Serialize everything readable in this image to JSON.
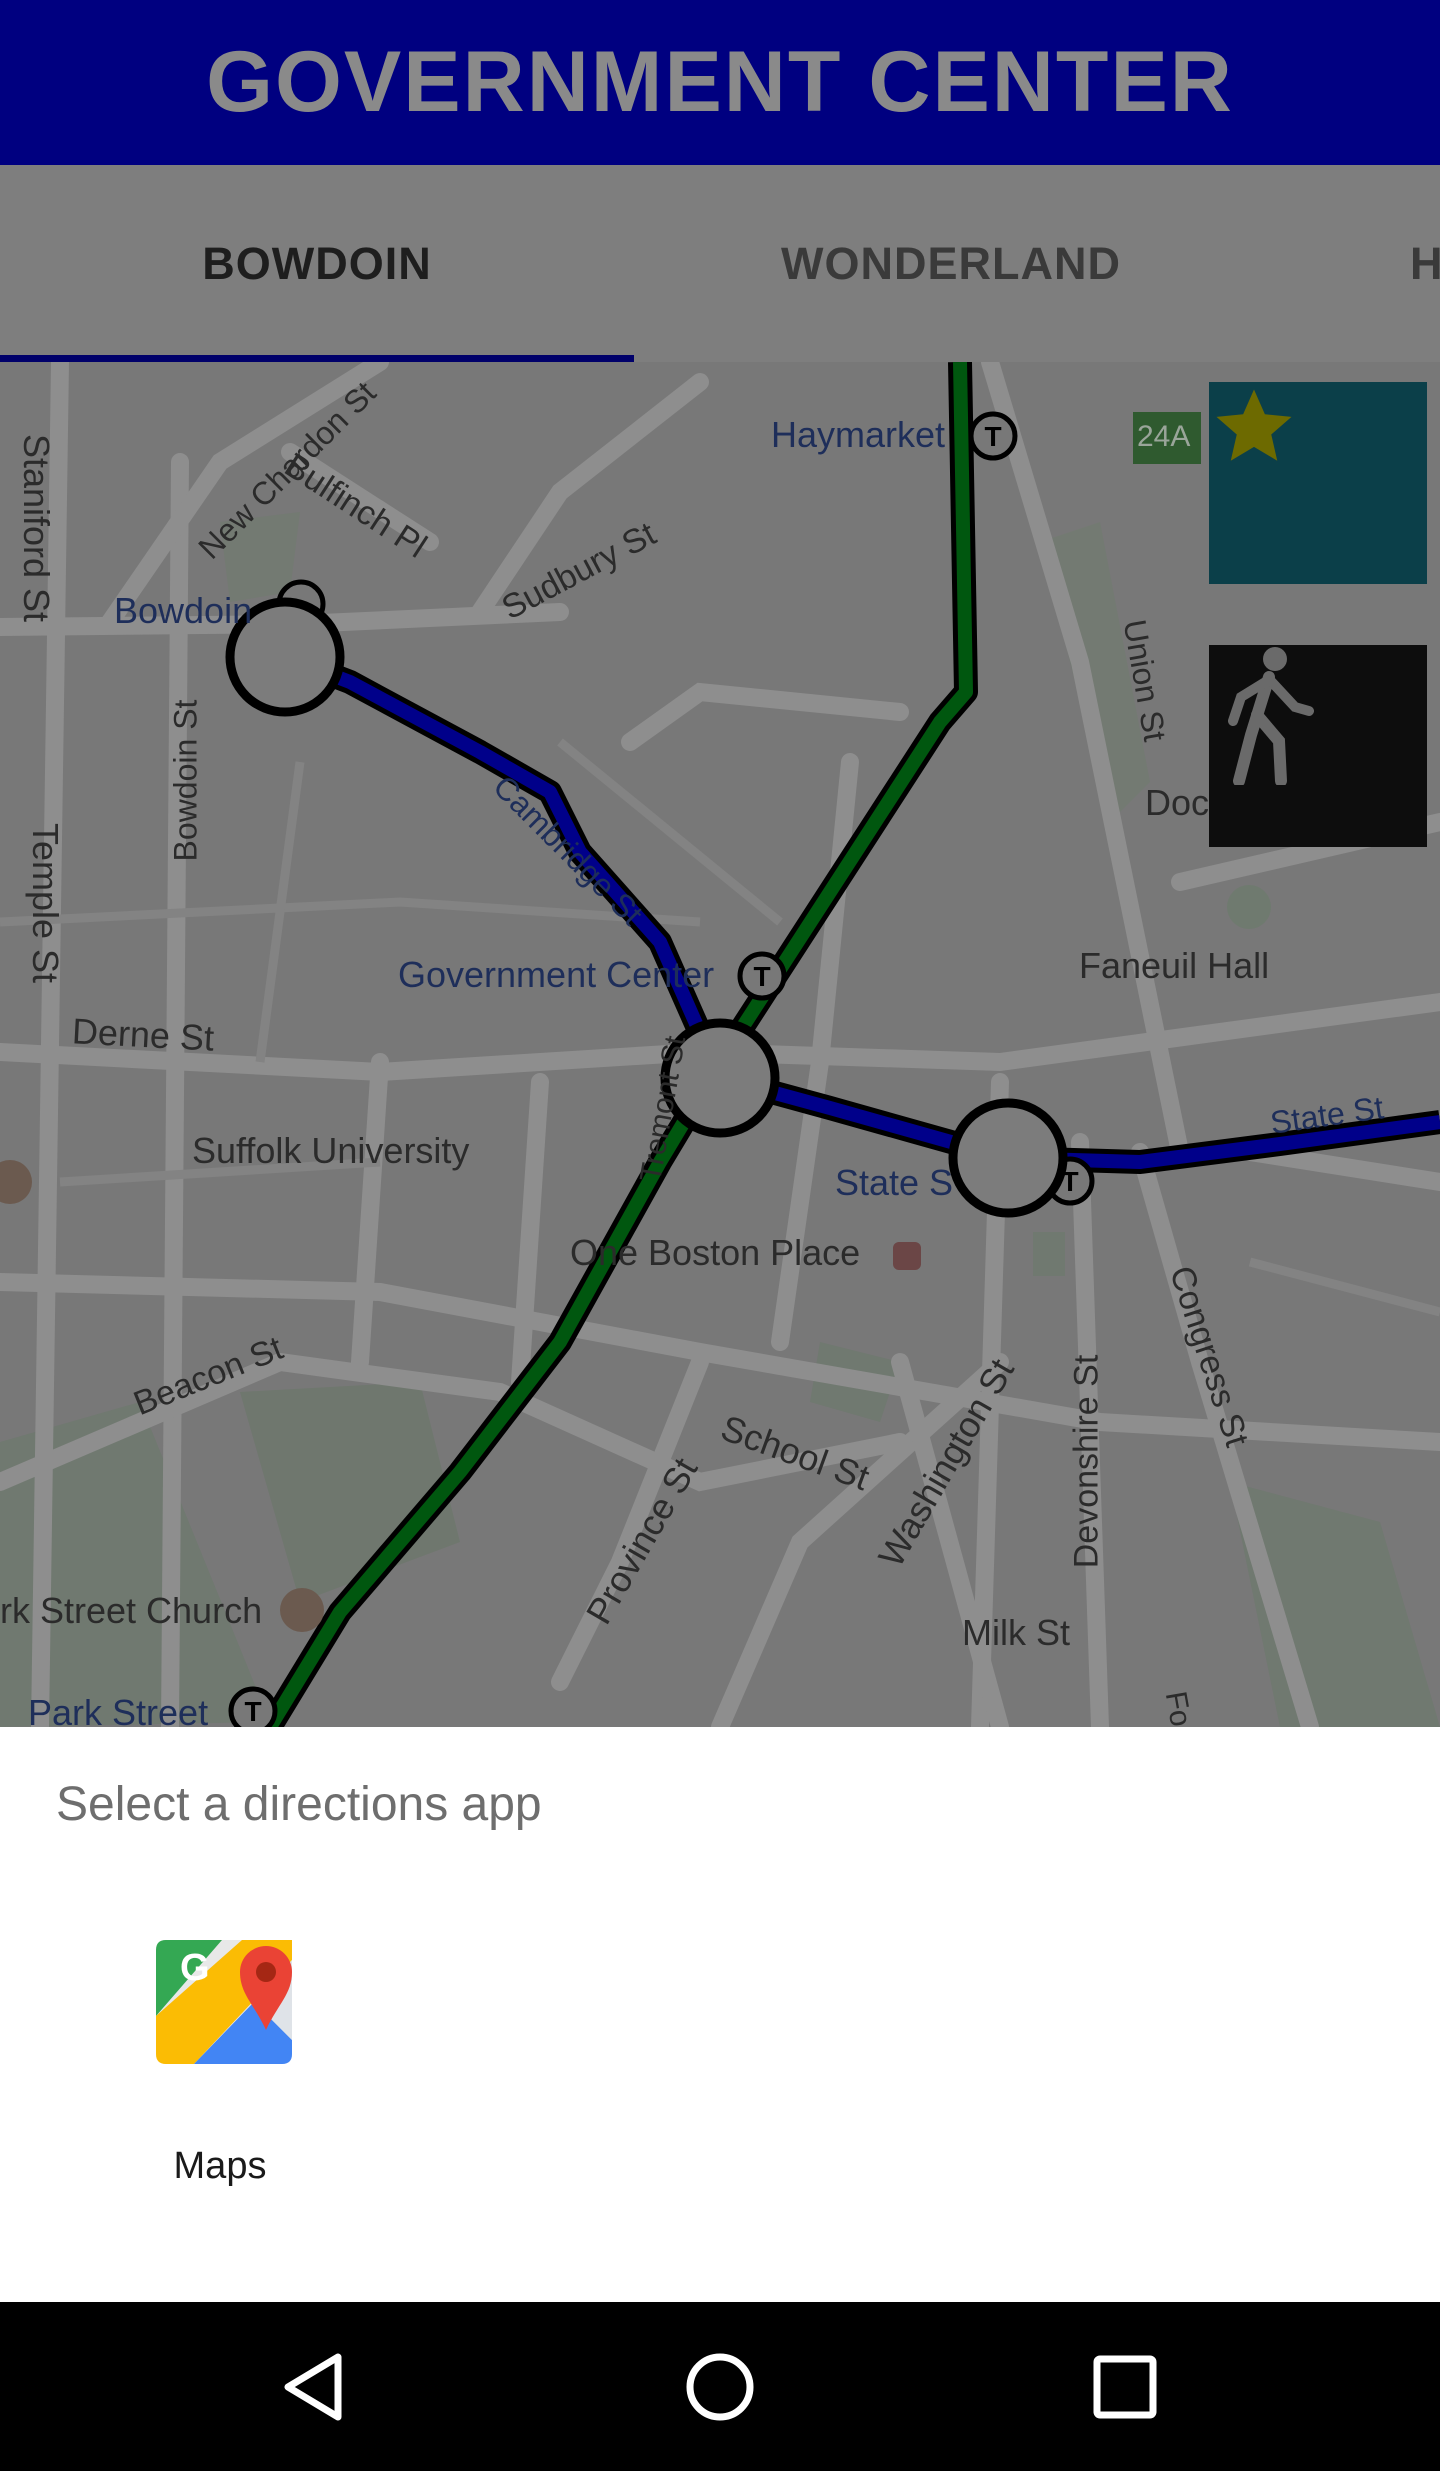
{
  "header": {
    "title": "GOVERNMENT CENTER"
  },
  "tabs": [
    {
      "label": "BOWDOIN",
      "selected": true
    },
    {
      "label": "WONDERLAND",
      "selected": false
    },
    {
      "label": "H",
      "selected": false
    }
  ],
  "map": {
    "labels": {
      "haymarket": "Haymarket",
      "badge_24a": "24A",
      "staniford": "Staniford St",
      "new_chardon": "New Chardon St",
      "bulfinch": "Bulfinch Pl",
      "sudbury": "Sudbury St",
      "bowdoin_station": "Bowdoin",
      "bowdoin_st": "Bowdoin St",
      "temple": "Temple St",
      "cambridge": "Cambridge St",
      "union": "Union St",
      "dock": "Doc",
      "faneuil": "Faneuil Hall",
      "gov_center": "Government Center",
      "derne": "Derne St",
      "tremont": "Tremont St",
      "suffolk": "Suffolk University",
      "state_st_station": "State S",
      "state_st_road": "State St",
      "one_boston": "One Boston Place",
      "beacon": "Beacon St",
      "school": "School St",
      "washington": "Washington St",
      "devonshire": "Devonshire St",
      "congress": "Congress St",
      "province": "Province St",
      "park_street_church": "rk Street Church",
      "milk": "Milk St",
      "park_street": "Park Street",
      "fo": "Fo"
    },
    "buttons": {
      "favorite_icon": "star-icon",
      "walk_icon": "walking-person-icon"
    },
    "colors": {
      "blue_line": "#00008a",
      "green_line": "#00570f",
      "favorite_bg": "#0b3f49",
      "star": "#6d6a00"
    }
  },
  "chooser": {
    "title": "Select a directions app",
    "apps": [
      {
        "label": "Maps",
        "icon": "google-maps-icon"
      }
    ]
  },
  "navbar": {
    "back_icon": "back-triangle-icon",
    "home_icon": "home-circle-icon",
    "recents_icon": "recents-square-icon"
  }
}
